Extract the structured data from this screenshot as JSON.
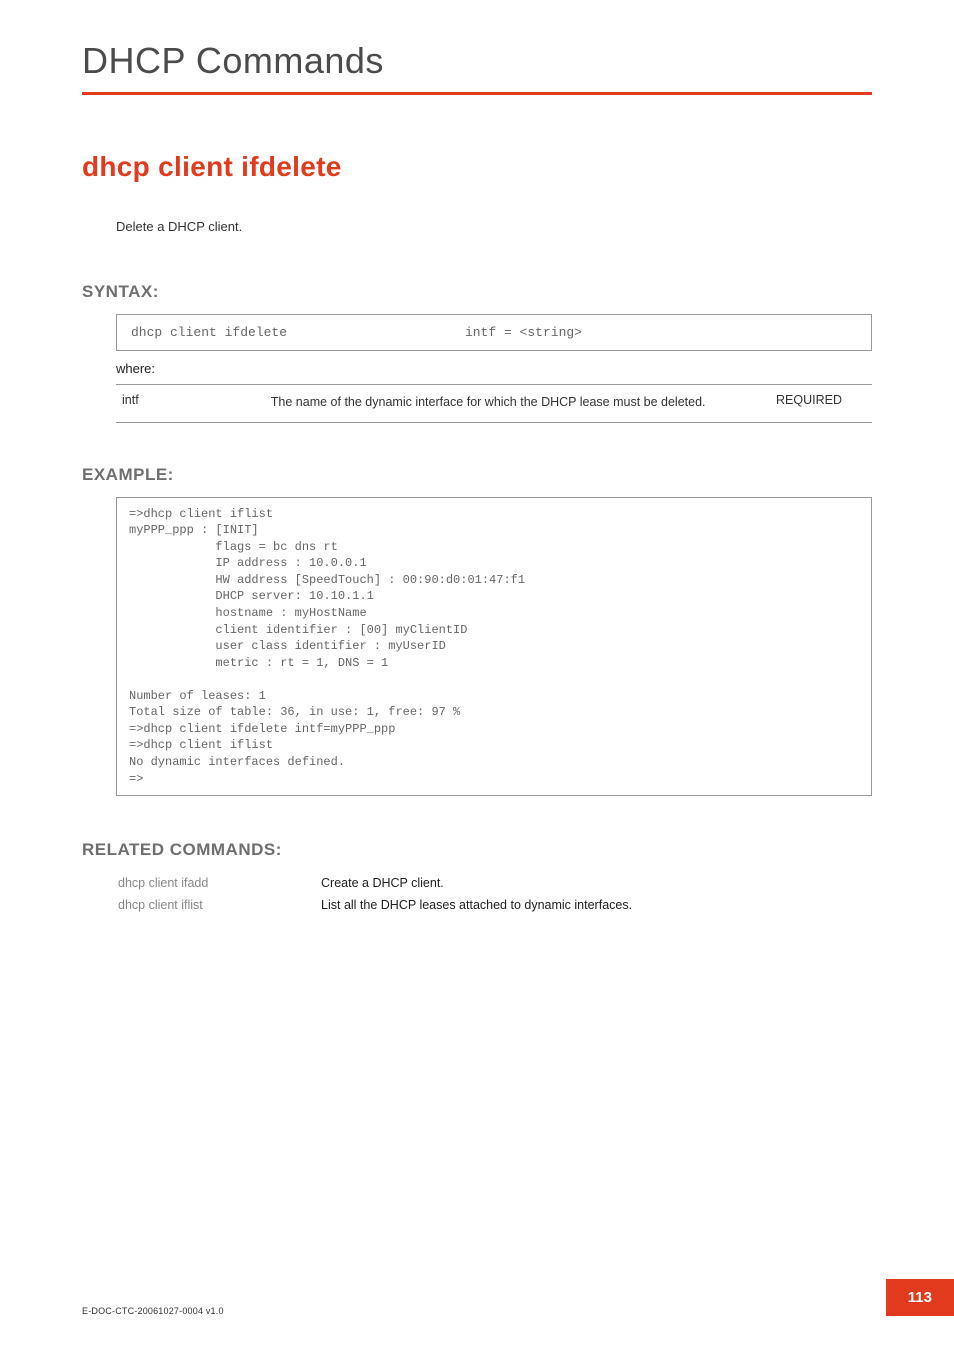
{
  "header": {
    "title": "DHCP Commands"
  },
  "command": {
    "title": "dhcp client ifdelete",
    "description": "Delete a DHCP client."
  },
  "syntax": {
    "label": "SYNTAX:",
    "command": "dhcp client ifdelete",
    "args": "intf = <string>",
    "where": "where:",
    "params": [
      {
        "name": "intf",
        "desc": "The name of the dynamic interface for which the DHCP lease must be deleted.",
        "req": "REQUIRED"
      }
    ]
  },
  "example": {
    "label": "EXAMPLE:",
    "body": "=>dhcp client iflist\nmyPPP_ppp : [INIT]\n            flags = bc dns rt\n            IP address : 10.0.0.1\n            HW address [SpeedTouch] : 00:90:d0:01:47:f1\n            DHCP server: 10.10.1.1\n            hostname : myHostName\n            client identifier : [00] myClientID\n            user class identifier : myUserID\n            metric : rt = 1, DNS = 1\n\nNumber of leases: 1\nTotal size of table: 36, in use: 1, free: 97 %\n=>dhcp client ifdelete intf=myPPP_ppp\n=>dhcp client iflist\nNo dynamic interfaces defined.\n=>"
  },
  "related": {
    "label": "RELATED COMMANDS:",
    "rows": [
      {
        "cmd": "dhcp client ifadd",
        "desc": "Create a DHCP client."
      },
      {
        "cmd": "dhcp client iflist",
        "desc": "List all the DHCP leases attached to dynamic interfaces."
      }
    ]
  },
  "footer": {
    "docid": "E-DOC-CTC-20061027-0004 v1.0",
    "page": "113"
  }
}
